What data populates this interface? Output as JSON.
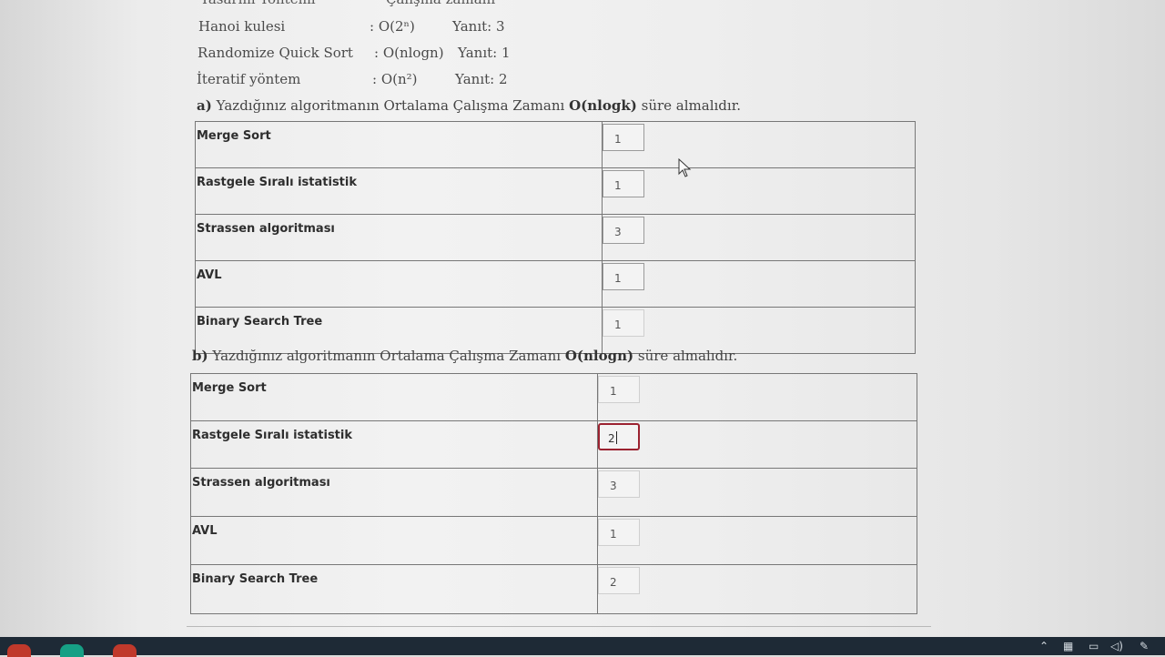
{
  "header": {
    "col1": "Tasarım Yöntemi",
    "col2": "Çalışma zamanı"
  },
  "intro_rows": [
    {
      "name": "Hanoi kulesi",
      "complexity": ": O(2ⁿ)",
      "answer": "Yanıt: 3"
    },
    {
      "name": "Randomize Quick Sort",
      "complexity": ": O(nlogn)",
      "answer": "Yanıt: 1"
    },
    {
      "name": "İteratif yöntem",
      "complexity": ": O(n²)",
      "answer": "Yanıt: 2"
    }
  ],
  "question_a": {
    "label": "a)",
    "text_pre": "Yazdığınız algoritmanın Ortalama Çalışma Zamanı",
    "complexity": "O(nlogk)",
    "text_post": "süre almalıdır.",
    "rows": [
      {
        "name": "Merge Sort",
        "value": "1"
      },
      {
        "name": "Rastgele Sıralı istatistik",
        "value": "1"
      },
      {
        "name": "Strassen algoritması",
        "value": "3"
      },
      {
        "name": "AVL",
        "value": "1"
      },
      {
        "name": "Binary Search Tree",
        "value": "1"
      }
    ]
  },
  "question_b": {
    "label": "b)",
    "text_pre": "Yazdığınız algoritmanın Ortalama Çalışma Zamanı",
    "complexity": "O(nlogn)",
    "text_post": "süre almalıdır.",
    "rows": [
      {
        "name": "Merge Sort",
        "value": "1"
      },
      {
        "name": "Rastgele Sıralı istatistik",
        "value": "2"
      },
      {
        "name": "Strassen algoritması",
        "value": "3"
      },
      {
        "name": "AVL",
        "value": "1"
      },
      {
        "name": "Binary Search Tree",
        "value": "2"
      }
    ]
  },
  "colors": {
    "focus_border": "#9b2230",
    "taskbar": "#1e2a36"
  },
  "taskbar": {
    "tray_icons": [
      "chevron-up-icon",
      "network-icon",
      "battery-icon",
      "volume-icon",
      "pen-icon"
    ]
  }
}
